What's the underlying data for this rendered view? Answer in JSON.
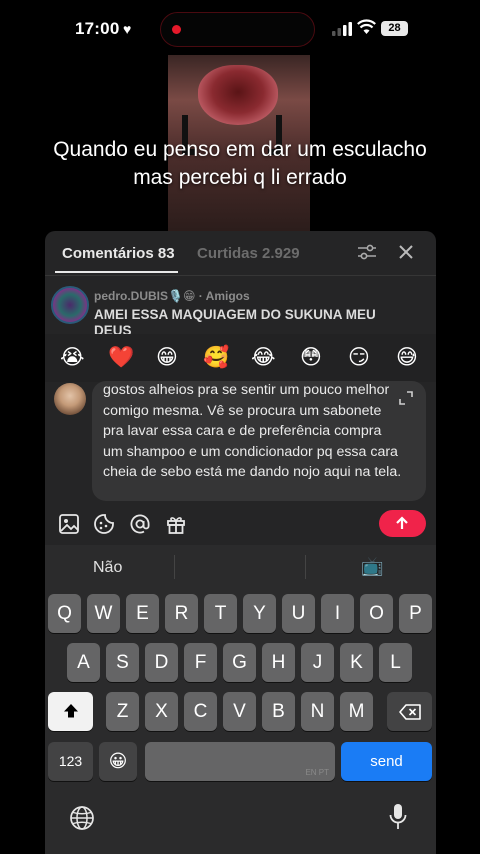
{
  "status_bar": {
    "time": "17:00",
    "battery": "28"
  },
  "video": {
    "caption": "Quando eu penso em dar um esculacho mas percebi q li errado"
  },
  "comments_sheet": {
    "tabs": [
      {
        "label": "Comentários 83"
      },
      {
        "label": "Curtidas 2.929"
      }
    ],
    "comment": {
      "author": "pedro.DUBIS🎙️😁 · Amigos",
      "text": "AMEI ESSA MAQUIAGEM DO SUKUNA MEU DEUS"
    },
    "emoji_bar": [
      "😭",
      "❤️",
      "😁",
      "🥰",
      "😂",
      "😳",
      "😏",
      "😅"
    ],
    "compose": {
      "text": "gostos alheios pra se sentir um pouco melhor comigo mesma. Vê se procura um sabonete pra lavar essa cara e de preferência compra um shampoo e um condicionador pq essa cara cheia de sebo está me dando nojo aqui na tela."
    }
  },
  "keyboard": {
    "suggestion": "Não",
    "suggestion_emoji": "📺",
    "row1": [
      "Q",
      "W",
      "E",
      "R",
      "T",
      "Y",
      "U",
      "I",
      "O",
      "P"
    ],
    "row2": [
      "A",
      "S",
      "D",
      "F",
      "G",
      "H",
      "J",
      "K",
      "L"
    ],
    "row3": [
      "Z",
      "X",
      "C",
      "V",
      "B",
      "N",
      "M"
    ],
    "numbers_label": "123",
    "emoji_key": "😀",
    "space_lang": "EN PT",
    "send_label": "send"
  }
}
